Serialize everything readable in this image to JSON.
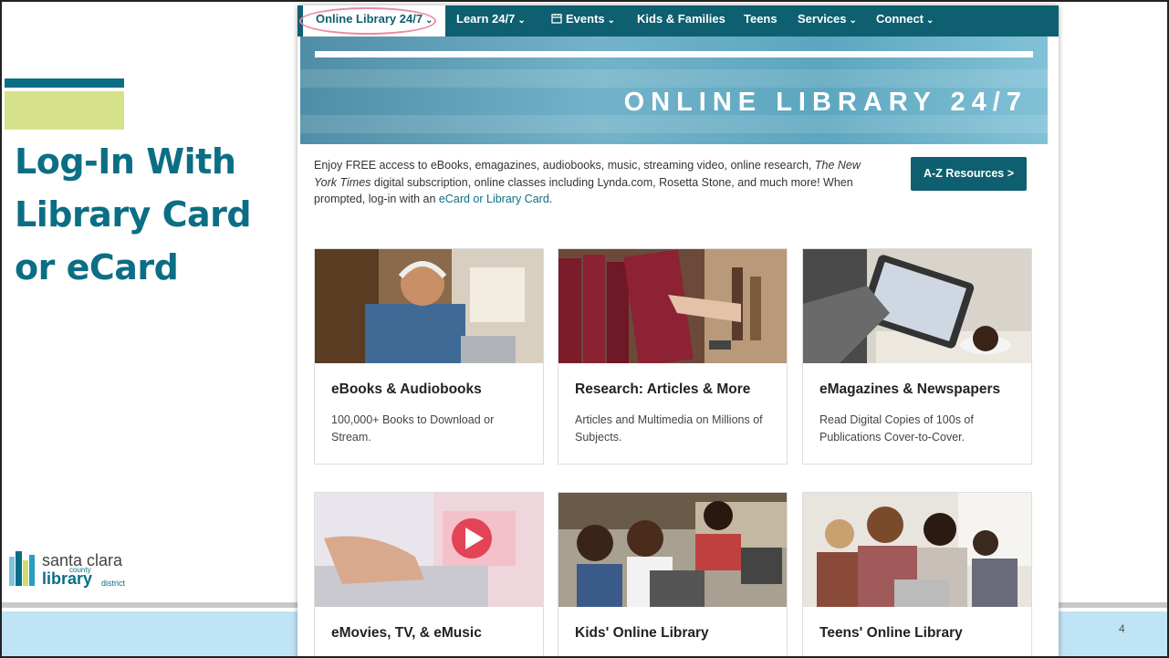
{
  "slide": {
    "title": "Log-In With Library Card or eCard",
    "page_number": "4",
    "logo": {
      "line1": "santa clara",
      "line2": "county",
      "line3": "library",
      "line4": "district"
    }
  },
  "website": {
    "nav": [
      {
        "label": "Online Library 24/7",
        "chevron": "⌄",
        "active": true
      },
      {
        "label": "Learn 24/7",
        "chevron": "⌄"
      },
      {
        "label": "Events",
        "chevron": "⌄",
        "icon": "calendar-icon"
      },
      {
        "label": "Kids & Families"
      },
      {
        "label": "Teens"
      },
      {
        "label": "Services",
        "chevron": "⌄"
      },
      {
        "label": "Connect",
        "chevron": "⌄"
      }
    ],
    "hero_title": "ONLINE LIBRARY 24/7",
    "intro": {
      "part1": "Enjoy FREE access to eBooks, emagazines, audiobooks, music, streaming video, online research, ",
      "italic": "The New York Times",
      "part2": " digital subscription, online classes including Lynda.com, Rosetta Stone, and much more!  When prompted, log-in with an ",
      "link": "eCard or Library Card",
      "part3": "."
    },
    "az_button": "A-Z Resources >",
    "cards": [
      {
        "title": "eBooks & Audiobooks",
        "desc": "100,000+ Books to Download or Stream."
      },
      {
        "title": "Research: Articles & More",
        "desc": "Articles and Multimedia on Millions of Subjects."
      },
      {
        "title": "eMagazines & Newspapers",
        "desc": "Read Digital Copies of 100s of Publications Cover-to-Cover."
      },
      {
        "title": "eMovies, TV, & eMusic",
        "desc": ""
      },
      {
        "title": "Kids' Online Library",
        "desc": ""
      },
      {
        "title": "Teens' Online Library",
        "desc": ""
      }
    ]
  }
}
